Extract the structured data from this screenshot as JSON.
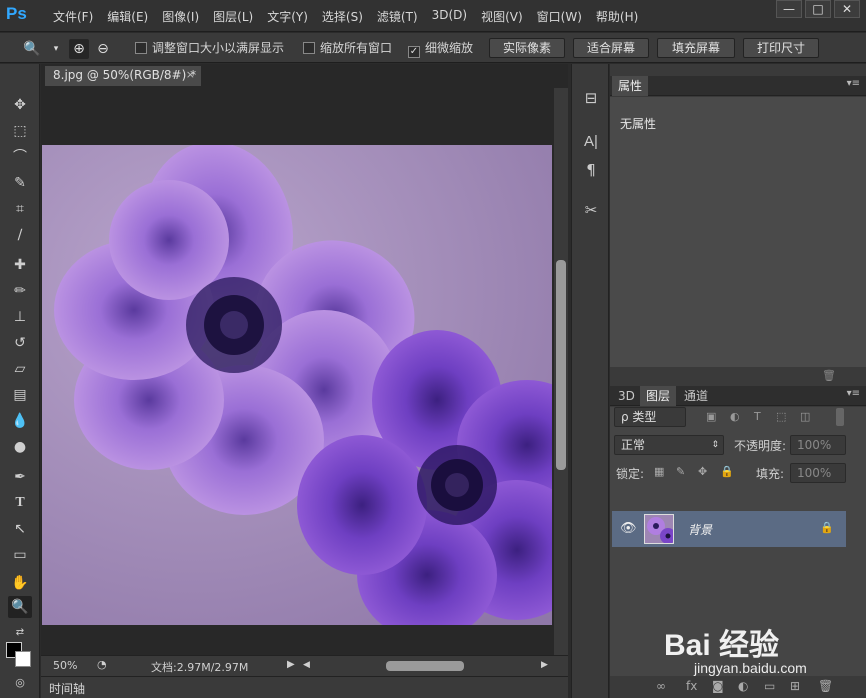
{
  "app": {
    "logo": "Ps"
  },
  "menu": [
    "文件(F)",
    "编辑(E)",
    "图像(I)",
    "图层(L)",
    "文字(Y)",
    "选择(S)",
    "滤镜(T)",
    "3D(D)",
    "视图(V)",
    "窗口(W)",
    "帮助(H)"
  ],
  "window_controls": {
    "minimize": "—",
    "maximize": "□",
    "close": "✕"
  },
  "options": {
    "resize_windows": "调整窗口大小以满屏显示",
    "resize_windows_checked": false,
    "zoom_all": "缩放所有窗口",
    "zoom_all_checked": false,
    "scrubby_zoom": "细微缩放",
    "scrubby_zoom_checked": true,
    "btn_actual": "实际像素",
    "btn_fit": "适合屏幕",
    "btn_fill": "填充屏幕",
    "btn_print": "打印尺寸"
  },
  "document": {
    "tab_title": "8.jpg @ 50%(RGB/8#) *",
    "close": "×",
    "zoom": "50%",
    "doc_info": "文档:2.97M/2.97M"
  },
  "timeline": {
    "label": "时间轴"
  },
  "properties": {
    "tab": "属性",
    "empty": "无属性"
  },
  "layers": {
    "tabs": [
      "3D",
      "图层",
      "通道"
    ],
    "filter_kind": "ρ 类型",
    "blend_mode": "正常",
    "opacity_label": "不透明度:",
    "opacity_value": "100%",
    "lock_label": "锁定:",
    "fill_label": "填充:",
    "fill_value": "100%",
    "layer_name": "背景"
  },
  "watermark": {
    "title": "Bai 经验",
    "url": "jingyan.baidu.com"
  },
  "colors": {
    "accent": "#31a8ff",
    "selected_layer": "#5b6b84",
    "canvas_bg": "#9d86b3"
  }
}
